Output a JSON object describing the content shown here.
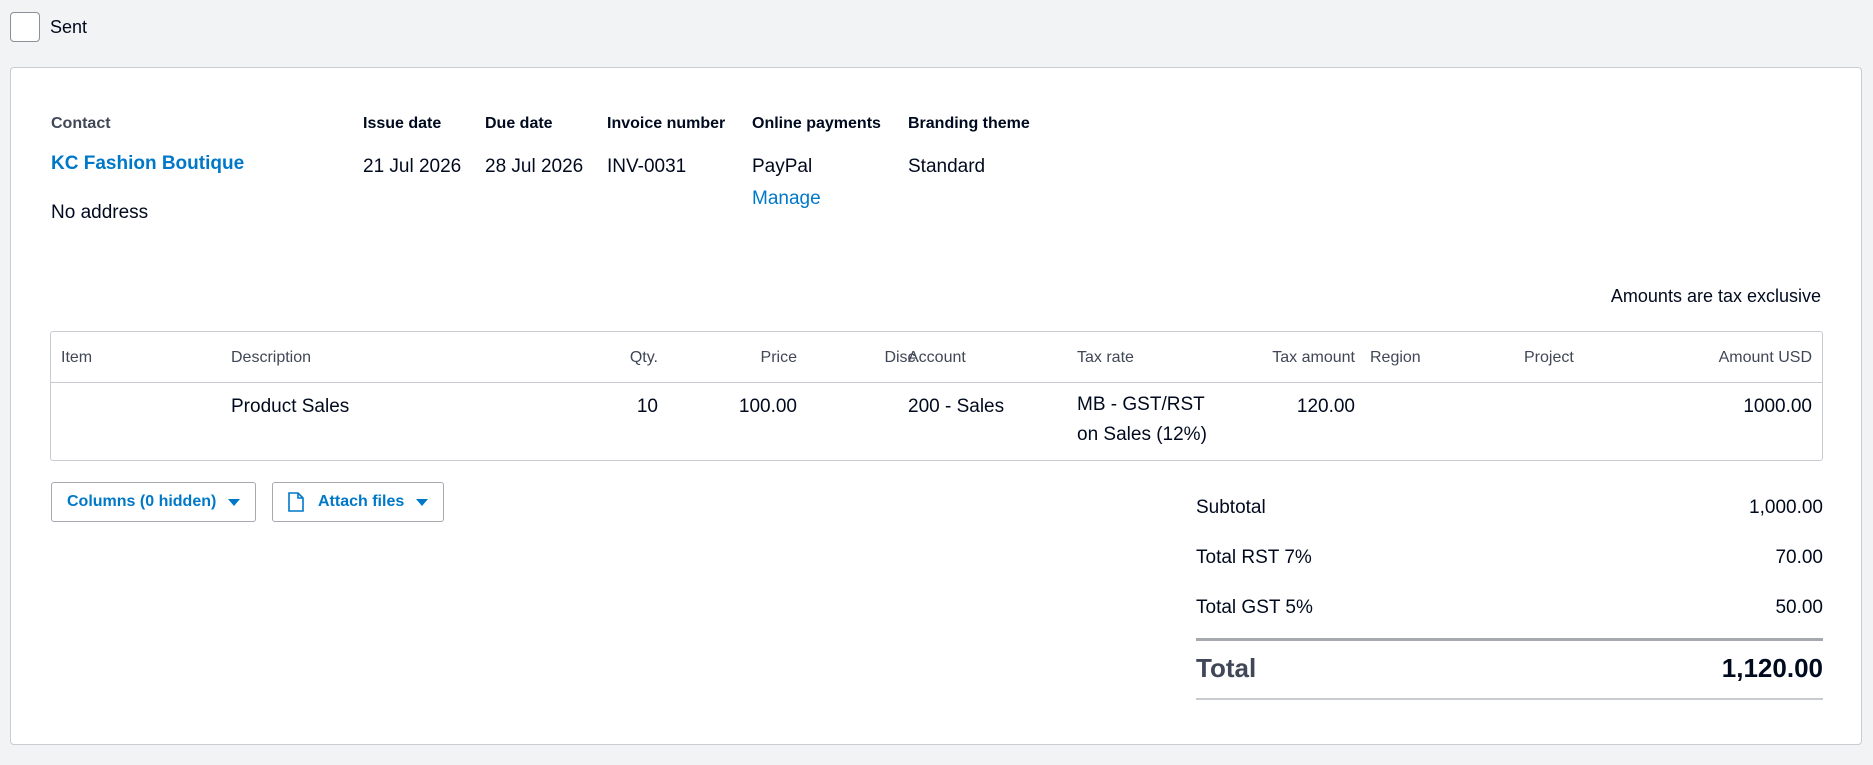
{
  "status": {
    "sent_label": "Sent"
  },
  "invoice": {
    "contact_label": "Contact",
    "contact_name": "KC Fashion Boutique",
    "address": "No address",
    "issue_date_label": "Issue date",
    "issue_date": "21 Jul 2026",
    "due_date_label": "Due date",
    "due_date": "28 Jul 2026",
    "invoice_number_label": "Invoice number",
    "invoice_number": "INV-0031",
    "online_payments_label": "Online payments",
    "online_payments": "PayPal",
    "manage_link": "Manage",
    "branding_theme_label": "Branding theme",
    "branding_theme": "Standard",
    "tax_note": "Amounts are tax exclusive"
  },
  "table": {
    "headers": {
      "item": "Item",
      "description": "Description",
      "qty": "Qty.",
      "price": "Price",
      "disc": "Disc.",
      "account": "Account",
      "tax_rate": "Tax rate",
      "tax_amount": "Tax amount",
      "region": "Region",
      "project": "Project",
      "amount": "Amount USD"
    },
    "rows": [
      {
        "item": "",
        "description": "Product Sales",
        "qty": "10",
        "price": "100.00",
        "disc": "",
        "account": "200 - Sales",
        "tax_rate": "MB - GST/RST on Sales (12%)",
        "tax_amount": "120.00",
        "region": "",
        "project": "",
        "amount": "1000.00"
      }
    ]
  },
  "actions": {
    "columns_button": "Columns (0 hidden)",
    "attach_button": "Attach files"
  },
  "totals": {
    "subtotal_label": "Subtotal",
    "subtotal": "1,000.00",
    "rst_label": "Total RST 7%",
    "rst": "70.00",
    "gst_label": "Total GST 5%",
    "gst": "50.00",
    "total_label": "Total",
    "total": "1,120.00"
  },
  "colors": {
    "link_blue": "#0078c8",
    "text": "#000a1e",
    "muted": "#404756",
    "border": "#c8ccd1",
    "background": "#f2f3f4"
  }
}
